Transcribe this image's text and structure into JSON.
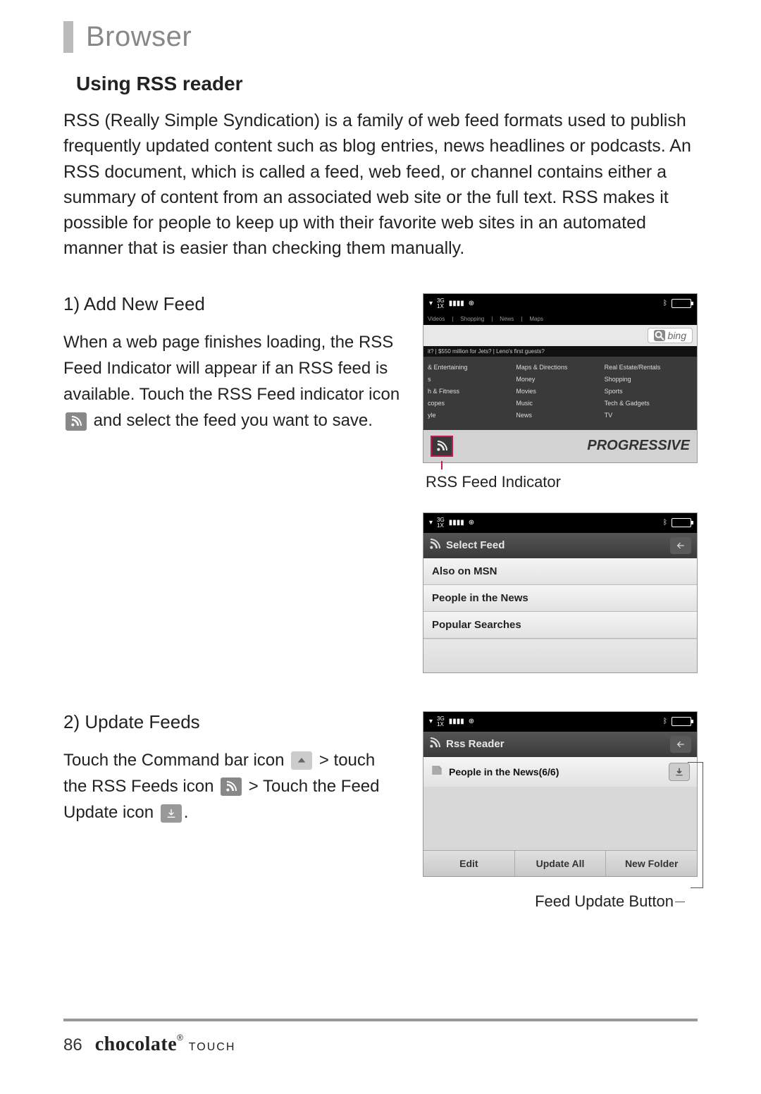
{
  "header": {
    "section": "Browser",
    "subtitle": "Using RSS reader"
  },
  "intro": "RSS (Really Simple Syndication) is a family of web feed formats used to publish frequently updated content such as blog entries, news headlines or podcasts. An RSS document, which is called a feed, web feed, or channel contains either a summary of content from an associated web site or the full text. RSS makes it possible for people to keep up with their favorite web sites in an automated manner that is easier than checking them manually.",
  "step1": {
    "title": "1) Add New Feed",
    "text_a": "When a web page finishes loading, the RSS Feed Indicator will appear if an RSS feed is available. Touch the RSS Feed indicator icon",
    "text_b": "and select the feed you want to save."
  },
  "shot1": {
    "nav": [
      "Videos",
      "Shopping",
      "News",
      "Maps"
    ],
    "search_engine": "bing",
    "ticker": "it?  |  $550 million for Jets?  |  Leno's first guests?",
    "cats_col1": [
      "& Entertaining",
      "s",
      "h & Fitness",
      "copes",
      "yle"
    ],
    "cats_col2": [
      "Maps & Directions",
      "Money",
      "Movies",
      "Music",
      "News"
    ],
    "cats_col3": [
      "Real Estate/Rentals",
      "Shopping",
      "Sports",
      "Tech & Gadgets",
      "TV"
    ],
    "ad": "PROGRESSIVE",
    "caption": "RSS Feed Indicator"
  },
  "shot2": {
    "title": "Select Feed",
    "items": [
      "Also on MSN",
      "People in the News",
      "Popular Searches"
    ]
  },
  "step2": {
    "title": "2) Update Feeds",
    "text_a": "Touch the Command bar icon",
    "gt1": ">",
    "text_b": "touch the RSS Feeds icon",
    "gt2": "> Touch",
    "text_c": "the Feed Update icon",
    "period": "."
  },
  "shot3": {
    "title": "Rss Reader",
    "item": "People in the News(6/6)",
    "buttons": [
      "Edit",
      "Update All",
      "New Folder"
    ],
    "callout": "Feed Update Button"
  },
  "footer": {
    "page": "86",
    "brand_main": "chocolate",
    "brand_sub": "TOUCH"
  }
}
